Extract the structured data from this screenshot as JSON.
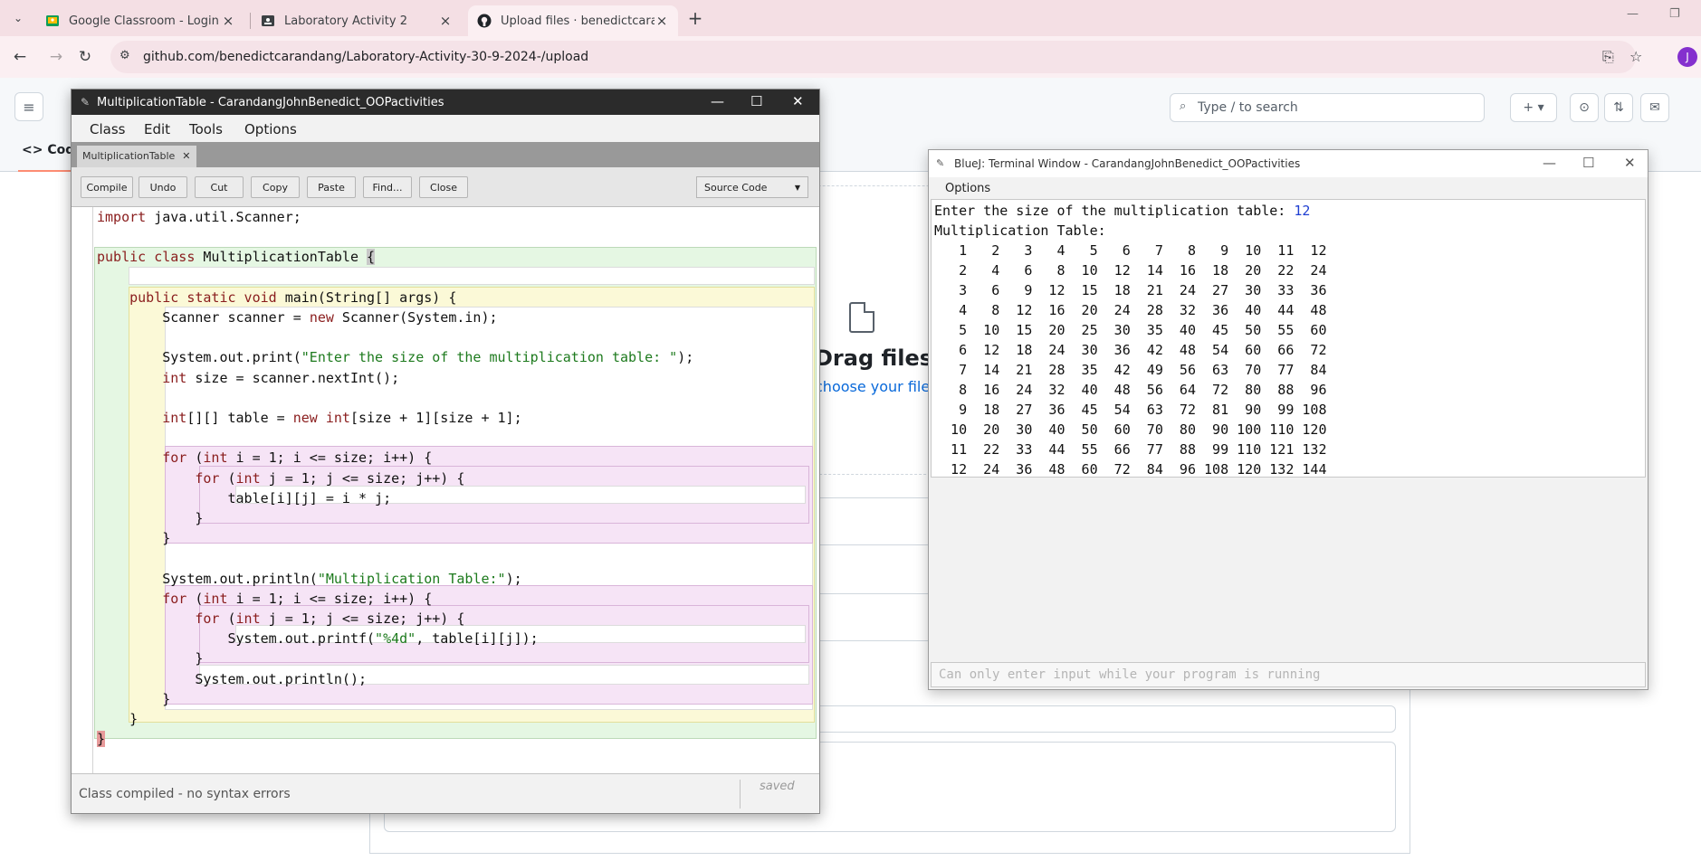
{
  "browser": {
    "tabs": [
      {
        "title": "Google Classroom - Login",
        "active": false
      },
      {
        "title": "Laboratory Activity 2",
        "active": false
      },
      {
        "title": "Upload files · benedictcarandang",
        "active": true
      }
    ],
    "url": "github.com/benedictcarandang/Laboratory-Activity-30-9-2024-/upload",
    "profile_initial": "J"
  },
  "github": {
    "search_placeholder": "Type / to search",
    "tab_code": "Code",
    "drag_text": "Drag files here to add them",
    "choose_text": "choose your files"
  },
  "editor": {
    "title": "MultiplicationTable - CarandangJohnBenedict_OOPactivities",
    "menus": [
      "Class",
      "Edit",
      "Tools",
      "Options"
    ],
    "file_tab": "MultiplicationTable",
    "buttons": [
      "Compile",
      "Undo",
      "Cut",
      "Copy",
      "Paste",
      "Find...",
      "Close"
    ],
    "view_mode": "Source Code",
    "status": "Class compiled - no syntax errors",
    "saved": "saved"
  },
  "terminal": {
    "title": "BlueJ: Terminal Window - CarandangJohnBenedict_OOPactivities",
    "menu_options": "Options",
    "prompt": "Enter the size of the multiplication table: ",
    "input_value": "12",
    "heading": "Multiplication Table:",
    "rows": [
      "   1   2   3   4   5   6   7   8   9  10  11  12",
      "   2   4   6   8  10  12  14  16  18  20  22  24",
      "   3   6   9  12  15  18  21  24  27  30  33  36",
      "   4   8  12  16  20  24  28  32  36  40  44  48",
      "   5  10  15  20  25  30  35  40  45  50  55  60",
      "   6  12  18  24  30  36  42  48  54  60  66  72",
      "   7  14  21  28  35  42  49  56  63  70  77  84",
      "   8  16  24  32  40  48  56  64  72  80  88  96",
      "   9  18  27  36  45  54  63  72  81  90  99 108",
      "  10  20  30  40  50  60  70  80  90 100 110 120",
      "  11  22  33  44  55  66  77  88  99 110 121 132",
      "  12  24  36  48  60  72  84  96 108 120 132 144"
    ],
    "input_placeholder": "Can only enter input while your program is running"
  }
}
